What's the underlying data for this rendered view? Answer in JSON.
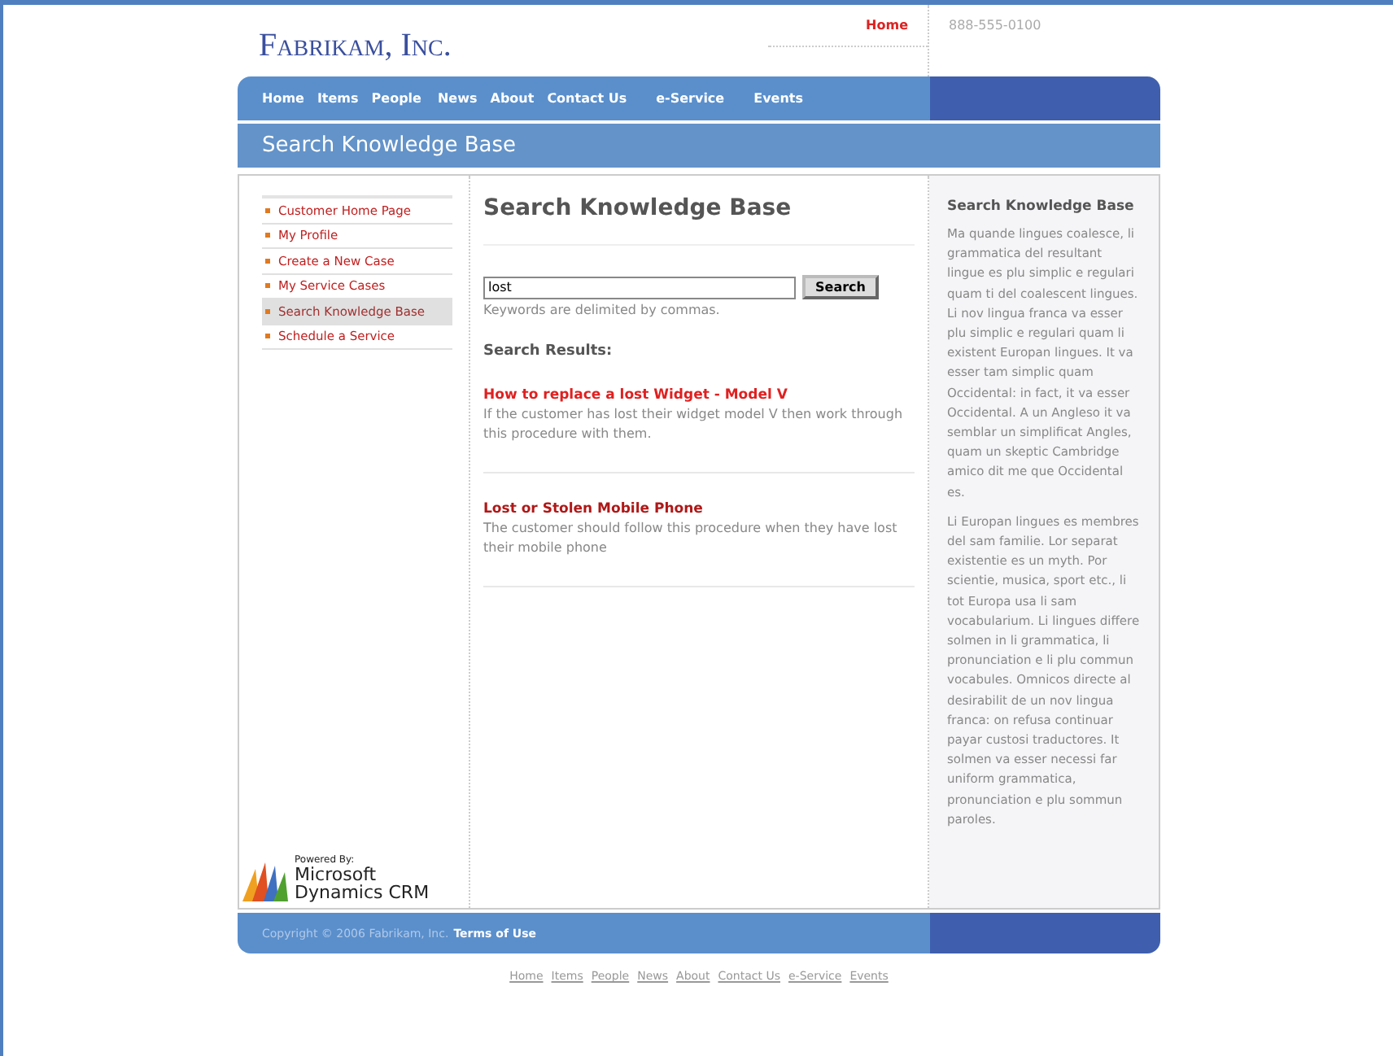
{
  "header": {
    "logo": "Fabrikam, Inc.",
    "top_link": "Home",
    "phone": "888-555-0100"
  },
  "nav": [
    "Home",
    "Items",
    "People",
    "News",
    "About",
    "Contact Us",
    "e-Service",
    "Events"
  ],
  "page_title": "Search Knowledge Base",
  "sidebar": {
    "items": [
      {
        "label": "Customer Home Page",
        "selected": false
      },
      {
        "label": "My Profile",
        "selected": false
      },
      {
        "label": "Create a New Case",
        "selected": false
      },
      {
        "label": "My Service Cases",
        "selected": false
      },
      {
        "label": "Search Knowledge Base",
        "selected": true
      },
      {
        "label": "Schedule a Service",
        "selected": false
      }
    ],
    "powered_by": {
      "caption": "Powered By:",
      "line_1": "Microsoft",
      "line_2": "Dynamics CRM"
    }
  },
  "main": {
    "heading": "Search Knowledge Base",
    "search": {
      "value": "lost",
      "button": "Search",
      "hint": "Keywords are delimited by commas."
    },
    "results_heading": "Search Results:",
    "results": [
      {
        "title": "How to replace a lost Widget - Model V",
        "summary": "If the customer has lost their widget model V then work through this procedure with them."
      },
      {
        "title": "Lost or Stolen Mobile Phone",
        "summary": "The customer should follow this procedure when they have lost their mobile phone"
      }
    ]
  },
  "aside": {
    "heading": "Search Knowledge Base",
    "paragraphs": [
      "Ma quande lingues coalesce, li grammatica del resultant lingue es plu simplic e regulari quam ti del coalescent lingues. Li nov lingua franca va esser plu simplic e regulari quam li existent Europan lingues. It va esser tam simplic quam Occidental: in fact, it va esser Occidental. A un Angleso it va semblar un simplificat Angles, quam un skeptic Cambridge amico dit me que Occidental es.",
      "Li Europan lingues es membres del sam familie. Lor separat existentie es un myth. Por scientie, musica, sport etc., li tot Europa usa li sam vocabularium. Li lingues differe solmen in li grammatica, li pronunciation e li plu commun vocabules. Omnicos directe al desirabilit de un nov lingua franca: on refusa continuar payar custosi traductores. It solmen va esser necessi far uniform grammatica, pronunciation e plu sommun paroles."
    ]
  },
  "footer": {
    "copyright": "Copyright © 2006 Fabrikam, Inc.",
    "terms": "Terms of Use"
  },
  "bottom_links": [
    "Home",
    "Items",
    "People",
    "News",
    "About",
    "Contact Us",
    "e-Service",
    "Events"
  ]
}
